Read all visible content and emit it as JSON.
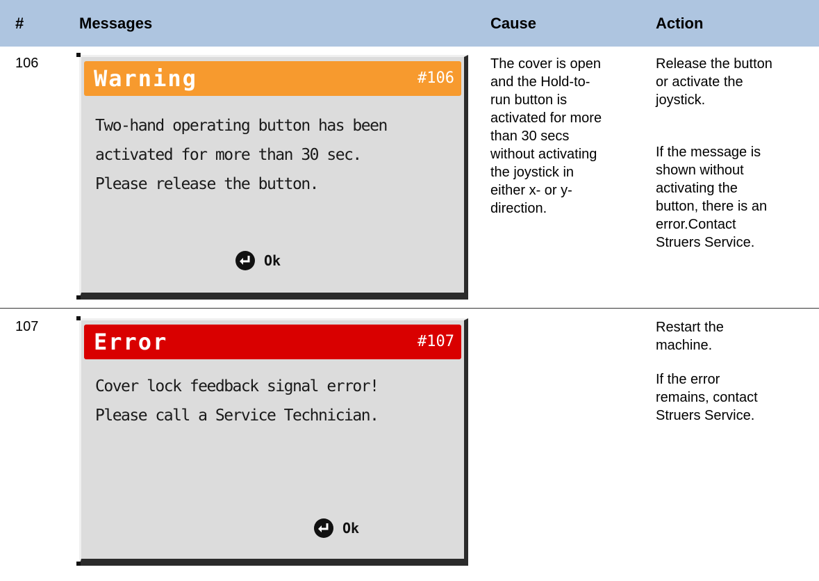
{
  "table": {
    "headers": {
      "number": "#",
      "messages": "Messages",
      "cause": "Cause",
      "action": "Action"
    },
    "rows": [
      {
        "number": "106",
        "screen": {
          "type": "Warning",
          "title": "Warning",
          "code": "#106",
          "bar_color": "#f79a2e",
          "message_lines": [
            "Two-hand operating button has been",
            "activated for more than 30 sec.",
            "Please release the button."
          ],
          "ok_label": "Ok",
          "ok_icon": "enter-return-icon"
        },
        "cause_lines": [
          "The cover is open",
          "and the Hold-to-",
          "run button is",
          "activated for more",
          "than 30 secs",
          "without activating",
          "the joystick in",
          "either x- or y-",
          "direction."
        ],
        "action_paragraphs": [
          [
            "Release the button",
            "or activate the",
            "joystick."
          ],
          [
            "If the message is",
            "shown without",
            "activating the",
            "button, there is an",
            "error.Contact",
            "Struers Service."
          ]
        ]
      },
      {
        "number": "107",
        "screen": {
          "type": "Error",
          "title": "Error",
          "code": "#107",
          "bar_color": "#d90000",
          "message_lines": [
            "Cover lock feedback signal error!",
            "Please call a Service Technician."
          ],
          "ok_label": "Ok",
          "ok_icon": "enter-return-icon"
        },
        "cause_lines": [],
        "action_paragraphs": [
          [
            "Restart the",
            "machine."
          ],
          [
            "If the error",
            "remains, contact",
            "Struers Service."
          ]
        ]
      }
    ]
  },
  "colors": {
    "header_bg": "#aec5e0",
    "screen_bg": "#dcdcdc",
    "warning_bar": "#f79a2e",
    "error_bar": "#d90000"
  }
}
